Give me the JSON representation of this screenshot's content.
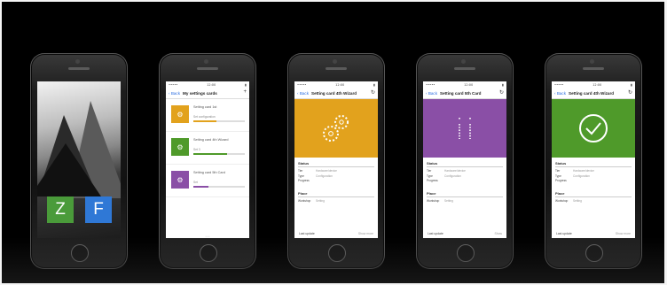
{
  "colors": {
    "background": "#000000",
    "orange": "#e2a21d",
    "purple": "#8a4fa6",
    "green": "#4f9a2a",
    "tile_green": "#4a9b3a",
    "tile_blue": "#2f78d6"
  },
  "phones": [
    {
      "type": "home",
      "tiles": [
        {
          "letter": "Z",
          "caption": ""
        },
        {
          "letter": "F",
          "caption": ""
        }
      ]
    },
    {
      "type": "list",
      "nav": {
        "back": "Back",
        "title": "My settings cards"
      },
      "items": [
        {
          "icon": "settings-icon",
          "title": "Setting card 1st",
          "sub": "Set configuration",
          "progress": 0.45
        },
        {
          "icon": "settings-icon",
          "title": "Setting card 4th Wizard",
          "sub": "Set 3",
          "progress": 0.65
        },
        {
          "icon": "settings-icon",
          "title": "Setting card 5th Card",
          "sub": "Set",
          "progress": 0.3
        }
      ]
    },
    {
      "type": "detail",
      "nav": {
        "back": "Back",
        "title": "Setting card 4th Wizard"
      },
      "banner_icon": "gears-icon",
      "status_label": "Status",
      "rows": [
        {
          "k": "Tier",
          "v": "Hardware/device"
        },
        {
          "k": "Type",
          "v": "Configuration"
        },
        {
          "k": "Progress",
          "v": ""
        }
      ],
      "place_label": "Place",
      "place_rows": [
        {
          "k": "Workshop",
          "v": "Setting"
        }
      ],
      "footer_left": "Last update",
      "footer_right": "Show more"
    },
    {
      "type": "detail",
      "nav": {
        "back": "Back",
        "title": "Setting card 5th Card"
      },
      "banner_icon": "info-icon",
      "status_label": "Status",
      "rows": [
        {
          "k": "Tier",
          "v": "Hardware/device"
        },
        {
          "k": "Type",
          "v": "Configuration"
        },
        {
          "k": "Progress",
          "v": ""
        }
      ],
      "place_label": "Place",
      "place_rows": [
        {
          "k": "Workshop",
          "v": "Setting"
        }
      ],
      "footer_left": "Last update",
      "footer_right": "Show"
    },
    {
      "type": "detail",
      "nav": {
        "back": "Back",
        "title": "Setting card 4th Wizard"
      },
      "banner_icon": "check-circle-icon",
      "status_label": "Status",
      "rows": [
        {
          "k": "Tier",
          "v": "Hardware/device"
        },
        {
          "k": "Type",
          "v": "Configuration"
        },
        {
          "k": "Progress",
          "v": ""
        }
      ],
      "place_label": "Place",
      "place_rows": [
        {
          "k": "Workshop",
          "v": "Setting"
        }
      ],
      "footer_left": "Last update",
      "footer_right": "Show more"
    }
  ],
  "statusbar": {
    "carrier": "••••• ",
    "time": "12:00",
    "battery": "▮"
  }
}
